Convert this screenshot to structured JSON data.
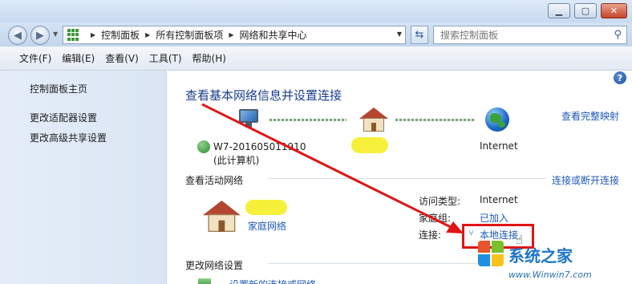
{
  "window": {
    "min_label": "▁",
    "max_label": "▢",
    "close_label": "✕"
  },
  "address": {
    "crumbs": [
      "控制面板",
      "所有控制面板项",
      "网络和共享中心"
    ],
    "search_placeholder": "搜索控制面板"
  },
  "menu": [
    "文件(F)",
    "编辑(E)",
    "查看(V)",
    "工具(T)",
    "帮助(H)"
  ],
  "leftnav": {
    "items": [
      "控制面板主页",
      "更改适配器设置",
      "更改高级共享设置"
    ]
  },
  "main": {
    "title": "查看基本网络信息并设置连接",
    "view_full_map": "查看完整映射",
    "computer_name": "W7-201605011910",
    "computer_sub": "(此计算机)",
    "internet_label": "Internet",
    "active_header": "查看活动网络",
    "connect_disconnect": "连接或断开连接",
    "network_name": "家庭网络",
    "access_type_label": "访问类型:",
    "access_type_value": "Internet",
    "homegroup_label": "家庭组:",
    "homegroup_value": "已加入",
    "connection_label": "连接:",
    "connection_value": "本地连接",
    "change_header": "更改网络设置",
    "setup_new": "设置新的连接或网络"
  },
  "watermark": {
    "title": "系统之家",
    "url": "www.Winwin7.com"
  },
  "colors": {
    "link": "#1f58b8",
    "title": "#1a3d8c",
    "highlight_box": "#e01414",
    "redaction": "#f7f03a"
  }
}
